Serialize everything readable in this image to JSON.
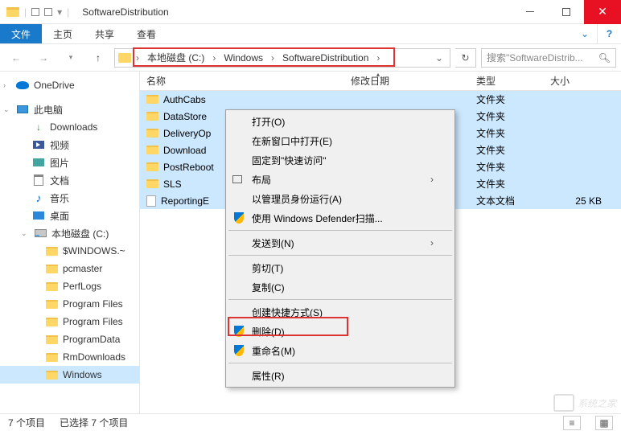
{
  "window": {
    "title": "SoftwareDistribution"
  },
  "ribbon": {
    "file": "文件",
    "tabs": [
      "主页",
      "共享",
      "查看"
    ]
  },
  "breadcrumb": [
    "本地磁盘 (C:)",
    "Windows",
    "SoftwareDistribution"
  ],
  "search": {
    "placeholder": "搜索\"SoftwareDistrib..."
  },
  "columns": {
    "name": "名称",
    "modified": "修改日期",
    "type": "类型",
    "size": "大小"
  },
  "col_widths": {
    "name": 254,
    "modified": 156,
    "type": 92,
    "size": 80
  },
  "files": [
    {
      "name": "AuthCabs",
      "type": "文件夹",
      "size": "",
      "icon": "folder"
    },
    {
      "name": "DataStore",
      "type": "文件夹",
      "size": "",
      "icon": "folder"
    },
    {
      "name": "DeliveryOp",
      "type": "文件夹",
      "size": "",
      "icon": "folder"
    },
    {
      "name": "Download",
      "type": "文件夹",
      "size": "",
      "icon": "folder"
    },
    {
      "name": "PostReboot",
      "type": "文件夹",
      "size": "",
      "icon": "folder"
    },
    {
      "name": "SLS",
      "type": "文件夹",
      "size": "",
      "icon": "folder"
    },
    {
      "name": "ReportingE",
      "type": "文本文档",
      "size": "25 KB",
      "icon": "txt"
    }
  ],
  "nav": {
    "onedrive": "OneDrive",
    "this_pc": "此电脑",
    "downloads": "Downloads",
    "videos": "视频",
    "pictures": "图片",
    "documents": "文档",
    "music": "音乐",
    "desktop": "桌面",
    "local_disk": "本地磁盘 (C:)",
    "folders": [
      "$WINDOWS.~",
      "pcmaster",
      "PerfLogs",
      "Program Files",
      "Program Files",
      "ProgramData",
      "RmDownloads",
      "Windows"
    ]
  },
  "context_menu": {
    "open": "打开(O)",
    "open_new_window": "在新窗口中打开(E)",
    "pin_quick": "固定到\"快速访问\"",
    "layout": "布局",
    "run_admin": "以管理员身份运行(A)",
    "defender": "使用 Windows Defender扫描...",
    "send_to": "发送到(N)",
    "cut": "剪切(T)",
    "copy": "复制(C)",
    "shortcut": "创建快捷方式(S)",
    "delete": "删除(D)",
    "rename": "重命名(M)",
    "properties": "属性(R)"
  },
  "status": {
    "count": "7 个项目",
    "selected": "已选择 7 个项目"
  },
  "watermark": "系统之家"
}
